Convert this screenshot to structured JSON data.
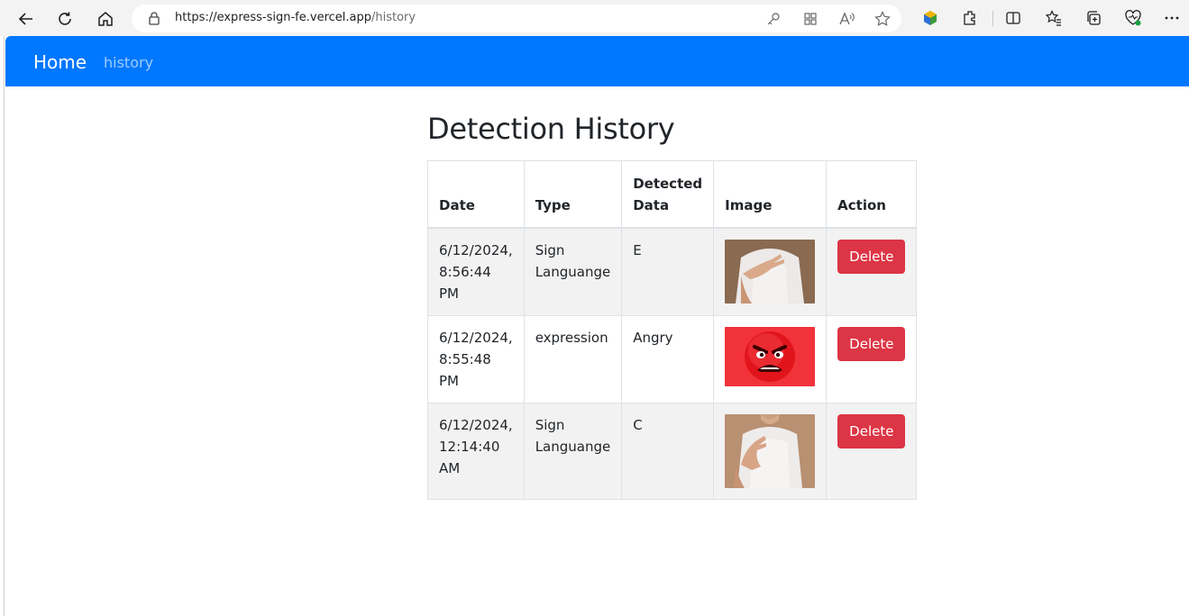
{
  "browser": {
    "url_host": "https://express-sign-fe.vercel.app",
    "url_path": "/history"
  },
  "navbar": {
    "brand": "Home",
    "link_history": "history"
  },
  "page": {
    "title": "Detection History"
  },
  "table": {
    "headers": {
      "date": "Date",
      "type": "Type",
      "detected": "Detected Data",
      "image": "Image",
      "action": "Action"
    },
    "rows": [
      {
        "date": "6/12/2024, 8:56:44 PM",
        "type": "Sign Languange",
        "detected": "E",
        "image_icon": "hand-sign-photo",
        "action": "Delete"
      },
      {
        "date": "6/12/2024, 8:55:48 PM",
        "type": "expression",
        "detected": "Angry",
        "image_icon": "angry-face-emoji",
        "action": "Delete"
      },
      {
        "date": "6/12/2024, 12:14:40 AM",
        "type": "Sign Languange",
        "detected": "C",
        "image_icon": "hand-sign-photo",
        "action": "Delete"
      }
    ]
  },
  "colors": {
    "navbar": "#0077ff",
    "delete_button": "#dc3545",
    "stripe": "#f2f2f2"
  }
}
